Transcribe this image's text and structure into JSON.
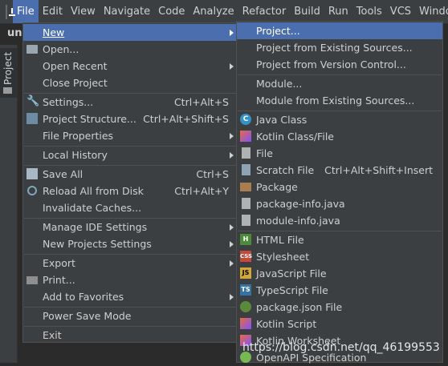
{
  "menubar": {
    "items": [
      "File",
      "Edit",
      "View",
      "Navigate",
      "Code",
      "Analyze",
      "Refactor",
      "Build",
      "Run",
      "Tools",
      "VCS",
      "Windo"
    ]
  },
  "breadcrumb": "un",
  "toolwindow": {
    "project_tab": "Project"
  },
  "file_menu": {
    "new": "New",
    "open": "Open...",
    "open_recent": "Open Recent",
    "close_project": "Close Project",
    "settings": "Settings...",
    "settings_sc": "Ctrl+Alt+S",
    "project_structure": "Project Structure...",
    "project_structure_sc": "Ctrl+Alt+Shift+S",
    "file_properties": "File Properties",
    "local_history": "Local History",
    "save_all": "Save All",
    "save_all_sc": "Ctrl+S",
    "reload": "Reload All from Disk",
    "reload_sc": "Ctrl+Alt+Y",
    "invalidate": "Invalidate Caches...",
    "manage_ide": "Manage IDE Settings",
    "new_projects_settings": "New Projects Settings",
    "export": "Export",
    "print": "Print...",
    "add_favorites": "Add to Favorites",
    "power_save": "Power Save Mode",
    "exit": "Exit"
  },
  "new_menu": {
    "project": "Project...",
    "existing_sources": "Project from Existing Sources...",
    "version_control": "Project from Version Control...",
    "module": "Module...",
    "module_existing": "Module from Existing Sources...",
    "java_class": "Java Class",
    "kotlin_class": "Kotlin Class/File",
    "file": "File",
    "scratch": "Scratch File",
    "scratch_sc": "Ctrl+Alt+Shift+Insert",
    "package": "Package",
    "package_info": "package-info.java",
    "module_info": "module-info.java",
    "html": "HTML File",
    "stylesheet": "Stylesheet",
    "js": "JavaScript File",
    "ts": "TypeScript File",
    "packagejson": "package.json File",
    "kotlin_script": "Kotlin Script",
    "kotlin_worksheet": "Kotlin Worksheet",
    "openapi": "OpenAPI Specification"
  },
  "icons": {
    "open": "folder-icon",
    "settings": "wrench-icon",
    "structure": "project-structure-icon",
    "save": "save-icon",
    "reload": "reload-icon",
    "print": "printer-icon"
  },
  "colors": {
    "selection": "#4b6eaf",
    "menu_bg": "#3c3f41"
  },
  "watermark": "https://blog.csdn.net/qq_46199553"
}
